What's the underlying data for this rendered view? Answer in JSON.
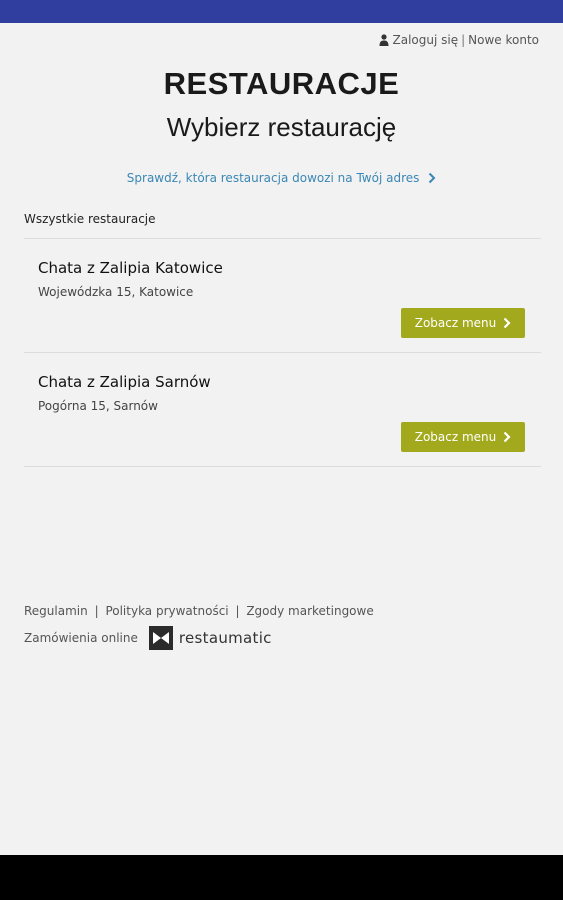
{
  "header": {
    "login_label": "Zaloguj się",
    "separator": "|",
    "register_label": "Nowe konto"
  },
  "title": "RESTAURACJE",
  "subtitle": "Wybierz restaurację",
  "check_address_label": "Sprawdź, która restauracja dowozi na Twój adres",
  "section_label": "Wszystkie restauracje",
  "restaurants": [
    {
      "name": "Chata z Zalipia Katowice",
      "address": "Wojewódzka 15, Katowice",
      "button_label": "Zobacz menu"
    },
    {
      "name": "Chata z Zalipia Sarnów",
      "address": "Pogórna 15, Sarnów",
      "button_label": "Zobacz menu"
    }
  ],
  "footer": {
    "terms": "Regulamin",
    "privacy": "Polityka prywatności",
    "consents": "Zgody marketingowe",
    "separator": "|",
    "powered_text": "Zamówienia online",
    "brand": "restaumatic"
  },
  "colors": {
    "status_bar": "#303f9f",
    "accent_link": "#3a87b5",
    "button": "#a3a91d",
    "background": "#f2f2f2"
  },
  "icons": [
    "user-icon",
    "chevron-right-icon",
    "restaumatic-logo-icon"
  ]
}
